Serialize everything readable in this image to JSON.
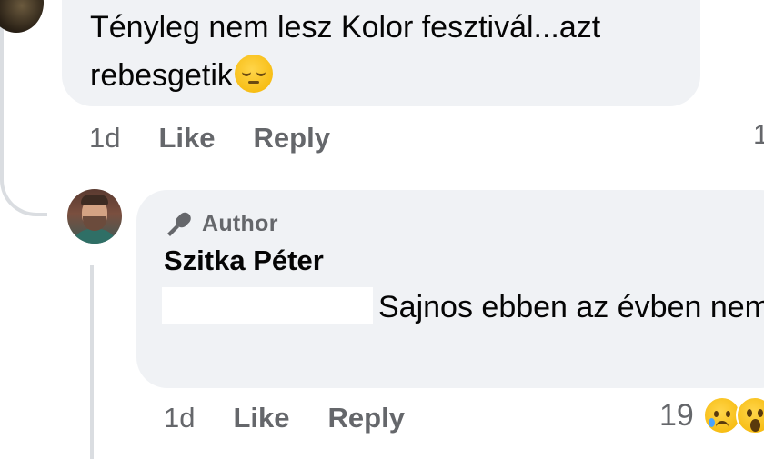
{
  "parent_comment": {
    "text": "Tényleg nem lesz Kolor fesztivál...azt rebesgetik",
    "emoji": "pensive-face",
    "time": "1d",
    "like_label": "Like",
    "reply_label": "Reply",
    "partial_count": "1"
  },
  "reply_comment": {
    "badge": "Author",
    "badge_icon": "microphone-icon",
    "author_name": "Szitka Péter",
    "text": "Sajnos ebben az évben nem.",
    "time": "1d",
    "like_label": "Like",
    "reply_label": "Reply",
    "reaction_count": "19",
    "reactions": [
      "sad-face",
      "wow-face"
    ]
  },
  "colors": {
    "bubble": "#f0f2f5",
    "meta_text": "#65676b",
    "text": "#050505",
    "thread_line": "#dadde1"
  }
}
